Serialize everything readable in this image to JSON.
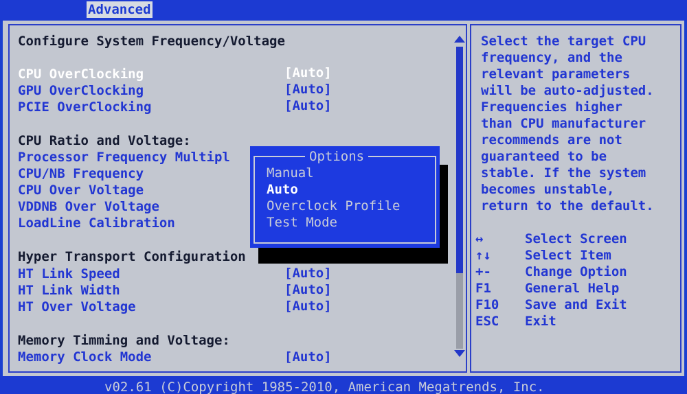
{
  "tabs": {
    "active": "Advanced"
  },
  "section_title": "Configure System Frequency/Voltage",
  "items_top": [
    {
      "label": "CPU OverClocking",
      "value": "[Auto]"
    },
    {
      "label": "GPU OverClocking",
      "value": "[Auto]"
    },
    {
      "label": "PCIE OverClocking",
      "value": "[Auto]"
    }
  ],
  "cpu_group_title": "CPU Ratio and Voltage:",
  "cpu_items": [
    "Processor Frequency Multipl",
    "CPU/NB Frequency",
    "CPU Over Voltage",
    "VDDNB Over Voltage",
    "LoadLine Calibration"
  ],
  "ht_group_title": "Hyper Transport Configuration",
  "ht_items": [
    {
      "label": "HT Link Speed",
      "value": "[Auto]"
    },
    {
      "label": "HT Link Width",
      "value": "[Auto]"
    },
    {
      "label": "HT Over Voltage",
      "value": "[Auto]"
    }
  ],
  "mem_group_title": "Memory Timming and Voltage:",
  "mem_items": [
    {
      "label": "Memory Clock Mode",
      "value": "[Auto]"
    }
  ],
  "help_lines": [
    "Select the target CPU",
    "frequency, and the",
    "relevant parameters",
    "will be auto-adjusted.",
    "Frequencies higher",
    "than CPU manufacturer",
    "recommends are not",
    "guaranteed to be",
    "stable. If the system",
    "becomes unstable,",
    "return to the default."
  ],
  "keys": [
    {
      "key": "↔",
      "desc": "Select Screen"
    },
    {
      "key": "↑↓",
      "desc": "Select Item"
    },
    {
      "key": "+-",
      "desc": "Change Option"
    },
    {
      "key": "F1",
      "desc": "General Help"
    },
    {
      "key": "F10",
      "desc": "Save and Exit"
    },
    {
      "key": "ESC",
      "desc": "Exit"
    }
  ],
  "popup": {
    "title": "Options",
    "options": [
      "Manual",
      "Auto",
      "Overclock Profile",
      "Test Mode"
    ],
    "selected_index": 1
  },
  "footer": "v02.61 (C)Copyright 1985-2010, American Megatrends, Inc."
}
